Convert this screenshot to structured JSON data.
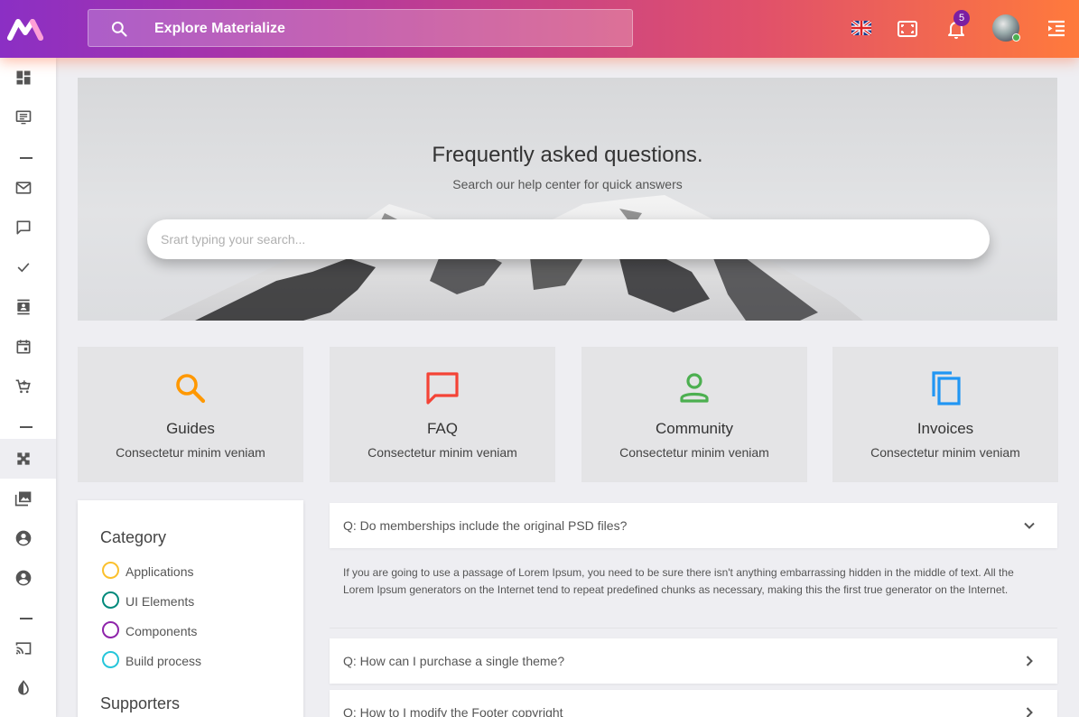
{
  "header": {
    "search_placeholder": "Explore Materialize",
    "notification_count": "5"
  },
  "hero": {
    "title": "Frequently asked questions.",
    "subtitle": "Search our help center for quick answers",
    "search_placeholder": "Srart typing your search..."
  },
  "cards": [
    {
      "title": "Guides",
      "subtitle": "Consectetur minim veniam",
      "icon": "search-icon",
      "color": "#ff9800"
    },
    {
      "title": "FAQ",
      "subtitle": "Consectetur minim veniam",
      "icon": "chat-icon",
      "color": "#f44336"
    },
    {
      "title": "Community",
      "subtitle": "Consectetur minim veniam",
      "icon": "person-icon",
      "color": "#4caf50"
    },
    {
      "title": "Invoices",
      "subtitle": "Consectetur minim veniam",
      "icon": "copy-icon",
      "color": "#2196f3"
    }
  ],
  "category": {
    "title": "Category",
    "items": [
      {
        "label": "Applications",
        "color": "#fbc02d"
      },
      {
        "label": "UI Elements",
        "color": "#00897b"
      },
      {
        "label": "Components",
        "color": "#8e24aa"
      },
      {
        "label": "Build process",
        "color": "#26c6da"
      }
    ],
    "supporters_title": "Supporters"
  },
  "faq": {
    "items": [
      {
        "question": "Q: Do memberships include the original PSD files?",
        "expanded": true
      },
      {
        "question": "Q: How can I purchase a single theme?",
        "expanded": false
      },
      {
        "question": "Q: How to I modify the Footer copyright",
        "expanded": false
      }
    ],
    "answer": "If you are going to use a passage of Lorem Ipsum, you need to be sure there isn't anything embarrassing hidden in the middle of text. All the Lorem Ipsum generators on the Internet tend to repeat predefined chunks as necessary, making this the first true generator on the Internet."
  },
  "sidebar": {
    "items": [
      "dashboard-icon",
      "templates-icon",
      "mail-icon",
      "chat-icon",
      "todo-icon",
      "contacts-icon",
      "calendar-icon",
      "ecommerce-icon",
      "pages-icon",
      "media-icon",
      "user-profile-icon",
      "account-icon",
      "cast-icon",
      "contrast-icon"
    ]
  }
}
